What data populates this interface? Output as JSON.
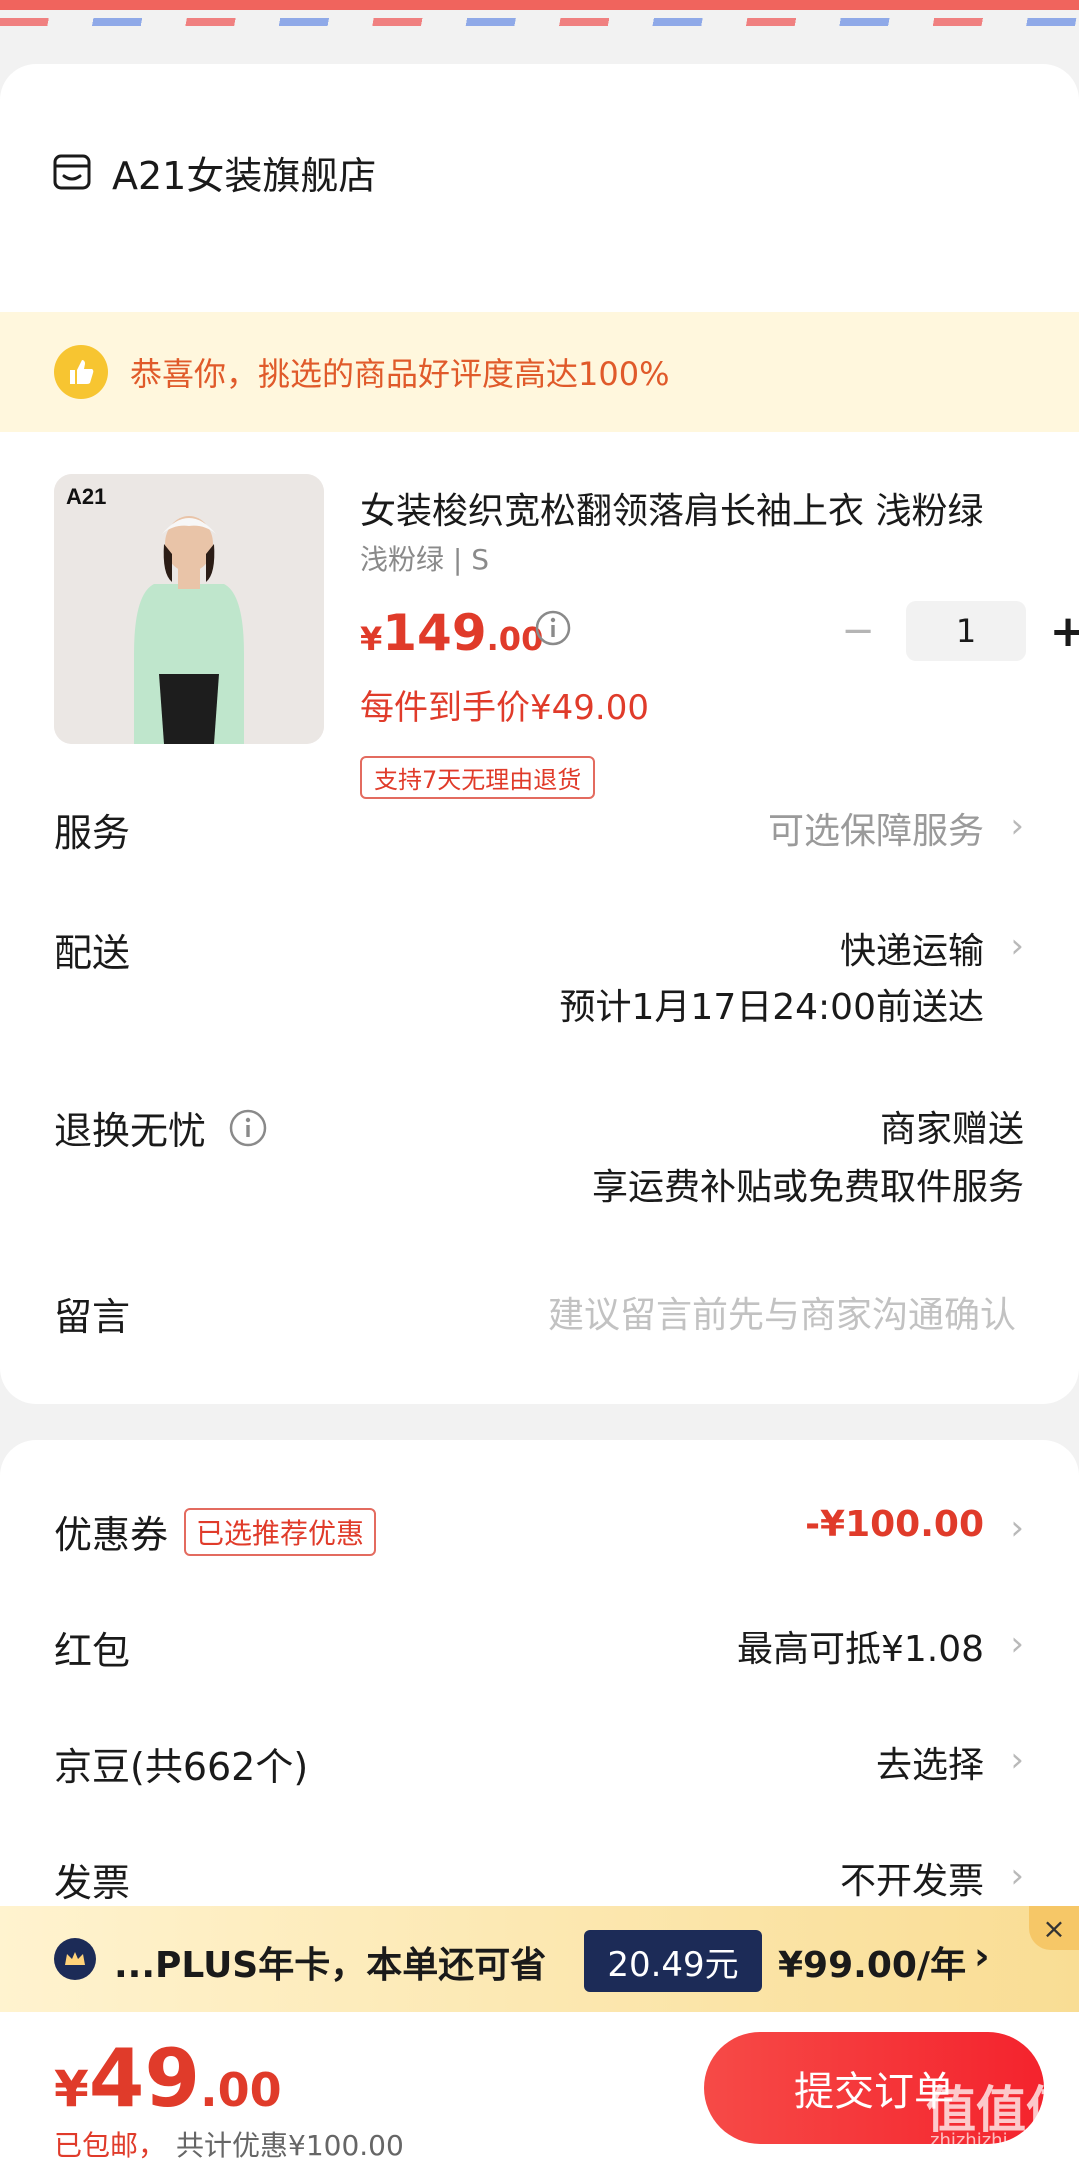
{
  "shop": {
    "name": "A21女装旗舰店",
    "icon": "store-icon"
  },
  "banner": {
    "text": "恭喜你，挑选的商品好评度高达100%",
    "icon": "thumbs-up-icon"
  },
  "product": {
    "image_brand": "A21",
    "title": "女装梭织宽松翻领落肩长袖上衣 浅粉绿",
    "spec": "浅粉绿 | S",
    "price_currency": "¥",
    "price_int": "149",
    "price_dec": ".00",
    "final_price": "每件到手价¥49.00",
    "return_tag": "支持7天无理由退货",
    "quantity": "1",
    "minus": "−",
    "plus": "+"
  },
  "rows": {
    "service": {
      "label": "服务",
      "value": "可选保障服务"
    },
    "delivery": {
      "label": "配送",
      "value": "快递运输",
      "eta": "预计1月17日24:00前送达"
    },
    "returns": {
      "label": "退换无忧",
      "value": "商家赠送",
      "value2": "享运费补贴或免费取件服务"
    },
    "message": {
      "label": "留言",
      "placeholder": "建议留言前先与商家沟通确认"
    }
  },
  "discounts": {
    "coupon": {
      "label": "优惠券",
      "badge": "已选推荐优惠",
      "value": "-¥100.00"
    },
    "redpacket": {
      "label": "红包",
      "value": "最高可抵¥1.08"
    },
    "jingdou": {
      "label": "京豆(共662个)",
      "value": "去选择"
    },
    "invoice": {
      "label": "发票",
      "value": "不开发票"
    }
  },
  "plus_bar": {
    "text": "...PLUS年卡，本单还可省",
    "save": "20.49元",
    "price": "¥99.00/年",
    "chevron": "›",
    "close": "×"
  },
  "footer": {
    "currency": "¥",
    "total_int": "49",
    "total_dec": ".00",
    "shipping": "已包邮，",
    "discount": "共计优惠¥100.00",
    "submit": "提交订单"
  },
  "watermark": {
    "text": "值值值",
    "url": "zhizhizhi.com"
  },
  "colors": {
    "accent": "#e03b2a",
    "banner_bg": "#fff7dd",
    "plus_navy": "#1c2b57"
  }
}
